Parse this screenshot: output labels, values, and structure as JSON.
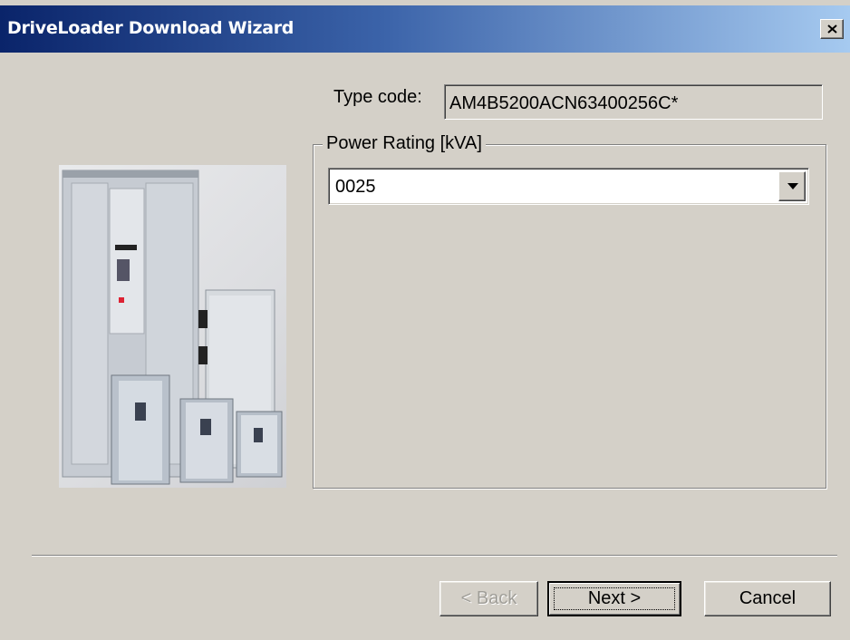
{
  "window": {
    "title": "DriveLoader Download Wizard"
  },
  "type_code": {
    "label": "Type code:",
    "value": "AM4B5200ACN63400256C*"
  },
  "power_rating": {
    "legend": "Power Rating [kVA]",
    "selected": "0025"
  },
  "buttons": {
    "back": "< Back",
    "next": "Next >",
    "cancel": "Cancel"
  },
  "icons": {
    "close": "close-icon",
    "dropdown": "chevron-down-icon"
  }
}
